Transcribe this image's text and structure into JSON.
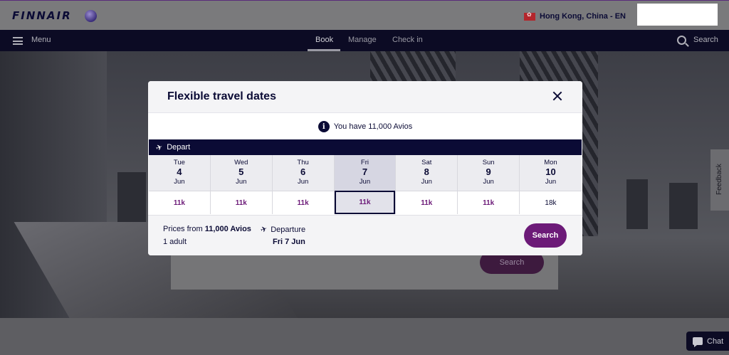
{
  "header": {
    "logo": "FINNAIR",
    "locale": "Hong Kong, China - EN"
  },
  "nav": {
    "menu_label": "Menu",
    "tabs": [
      {
        "label": "Book",
        "active": true
      },
      {
        "label": "Manage",
        "active": false
      },
      {
        "label": "Check in",
        "active": false
      }
    ],
    "search_label": "Search"
  },
  "background": {
    "search_button": "Search"
  },
  "side": {
    "feedback_label": "Feedback",
    "chat_label": "Chat"
  },
  "modal": {
    "title": "Flexible travel dates",
    "avios_message": "You have 11,000 Avios",
    "depart_label": "Depart",
    "days": [
      {
        "weekday": "Tue",
        "day": "4",
        "month": "Jun",
        "price": "11k",
        "selected": false,
        "highlight": true
      },
      {
        "weekday": "Wed",
        "day": "5",
        "month": "Jun",
        "price": "11k",
        "selected": false,
        "highlight": true
      },
      {
        "weekday": "Thu",
        "day": "6",
        "month": "Jun",
        "price": "11k",
        "selected": false,
        "highlight": true
      },
      {
        "weekday": "Fri",
        "day": "7",
        "month": "Jun",
        "price": "11k",
        "selected": true,
        "highlight": true
      },
      {
        "weekday": "Sat",
        "day": "8",
        "month": "Jun",
        "price": "11k",
        "selected": false,
        "highlight": true
      },
      {
        "weekday": "Sun",
        "day": "9",
        "month": "Jun",
        "price": "11k",
        "selected": false,
        "highlight": true
      },
      {
        "weekday": "Mon",
        "day": "10",
        "month": "Jun",
        "price": "18k",
        "selected": false,
        "highlight": false
      }
    ],
    "footer": {
      "prices_from_label": "Prices from",
      "prices_from_value": "11,000 Avios",
      "passengers": "1 adult",
      "departure_label": "Departure",
      "departure_date": "Fri 7 Jun",
      "search_button": "Search"
    }
  },
  "colors": {
    "navy": "#0b0b35",
    "purple": "#6c1a78"
  }
}
